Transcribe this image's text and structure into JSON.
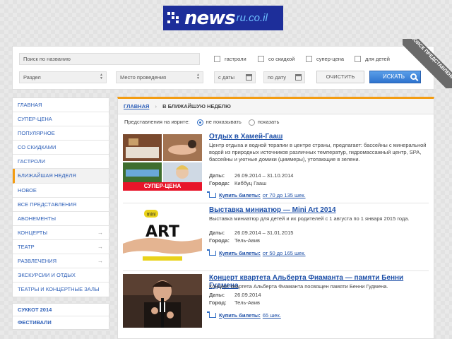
{
  "logo": {
    "word": "news",
    "domain": "ru.co.il"
  },
  "search": {
    "name_placeholder": "Поиск по названию",
    "section": "Раздел",
    "venue": "Место проведения",
    "from_date": "с даты",
    "to_date": "по дату",
    "checkboxes": [
      "гастроли",
      "со скидкой",
      "супер-цена",
      "для детей"
    ],
    "clear_label": "ОЧИСТИТЬ",
    "search_label": "ИСКАТЬ",
    "ribbon": "ПОИСК ПРЕДСТАВЛЕНИЯ"
  },
  "sidebar": {
    "items": [
      {
        "label": "ГЛАВНАЯ"
      },
      {
        "label": "СУПЕР-ЦЕНА"
      },
      {
        "label": "ПОПУЛЯРНОЕ"
      },
      {
        "label": "СО СКИДКАМИ"
      },
      {
        "label": "ГАСТРОЛИ"
      },
      {
        "label": "БЛИЖАЙШАЯ НЕДЕЛЯ"
      },
      {
        "label": "НОВОЕ"
      },
      {
        "label": "ВСЕ ПРЕДСТАВЛЕНИЯ"
      },
      {
        "label": "АБОНЕМЕНТЫ"
      },
      {
        "label": "КОНЦЕРТЫ"
      },
      {
        "label": "ТЕАТР"
      },
      {
        "label": "РАЗВЛЕЧЕНИЯ"
      },
      {
        "label": "ЭКСКУРСИИ И ОТДЫХ"
      },
      {
        "label": "ТЕАТРЫ И КОНЦЕРТНЫЕ ЗАЛЫ"
      }
    ],
    "extra": [
      {
        "label": "СУККОТ 2014"
      },
      {
        "label": "ФЕСТИВАЛИ"
      }
    ]
  },
  "breadcrumb": {
    "home": "ГЛАВНАЯ",
    "sep": "›",
    "current": "В БЛИЖАЙШУЮ НЕДЕЛЮ"
  },
  "lang_filter": {
    "label": "Представления на иврите:",
    "options": [
      "не показывать",
      "показать"
    ]
  },
  "events": [
    {
      "title": "Отдых в Хамей-Гааш",
      "desc": "Центр отдыха и водной терапии в центре страны, предлагает: бассейны с минеральной водой из природных источников различных температур, гидромассажный центр, SPA, бассейны и уютные домики (циммеры), утопающие в зелени.",
      "dates_label": "Даты:",
      "dates": "26.09.2014 – 31.10.2014",
      "city_label": "Города:",
      "city": "Киббуц Гааш",
      "buy_label": "Купить билеты:",
      "price": "от 70 до 135 шек.",
      "badge": "СУПЕР-ЦЕНА"
    },
    {
      "title": "Выставка миниатюр — Mini Art 2014",
      "desc": "Выставка миниатюр для детей и их родителей с 1 августа по 1 января 2015 года.",
      "dates_label": "Даты:",
      "dates": "26.09.2014 – 31.01.2015",
      "city_label": "Города:",
      "city": "Тель-Авив",
      "buy_label": "Купить билеты:",
      "price": "от 50 до 165 шек.",
      "thumb_top": "mini",
      "thumb_main": "ART"
    },
    {
      "title": "Концерт квартета Альберта Фиаманта — памяти Бенни Гудмена",
      "desc": "Концерт квартета Альберта Фиаманта посвящен памяти Бенни Гудмена.",
      "dates_label": "Даты:",
      "dates": "26.09.2014",
      "city_label": "Город:",
      "city": "Тель-Авив",
      "buy_label": "Купить билеты:",
      "price": "65 шек."
    }
  ],
  "colors": {
    "accent": "#f39c12",
    "link": "#1e50a8",
    "button": "#2e74cf",
    "badge": "#e8152a",
    "logo_bg": "#1d2e9a"
  }
}
